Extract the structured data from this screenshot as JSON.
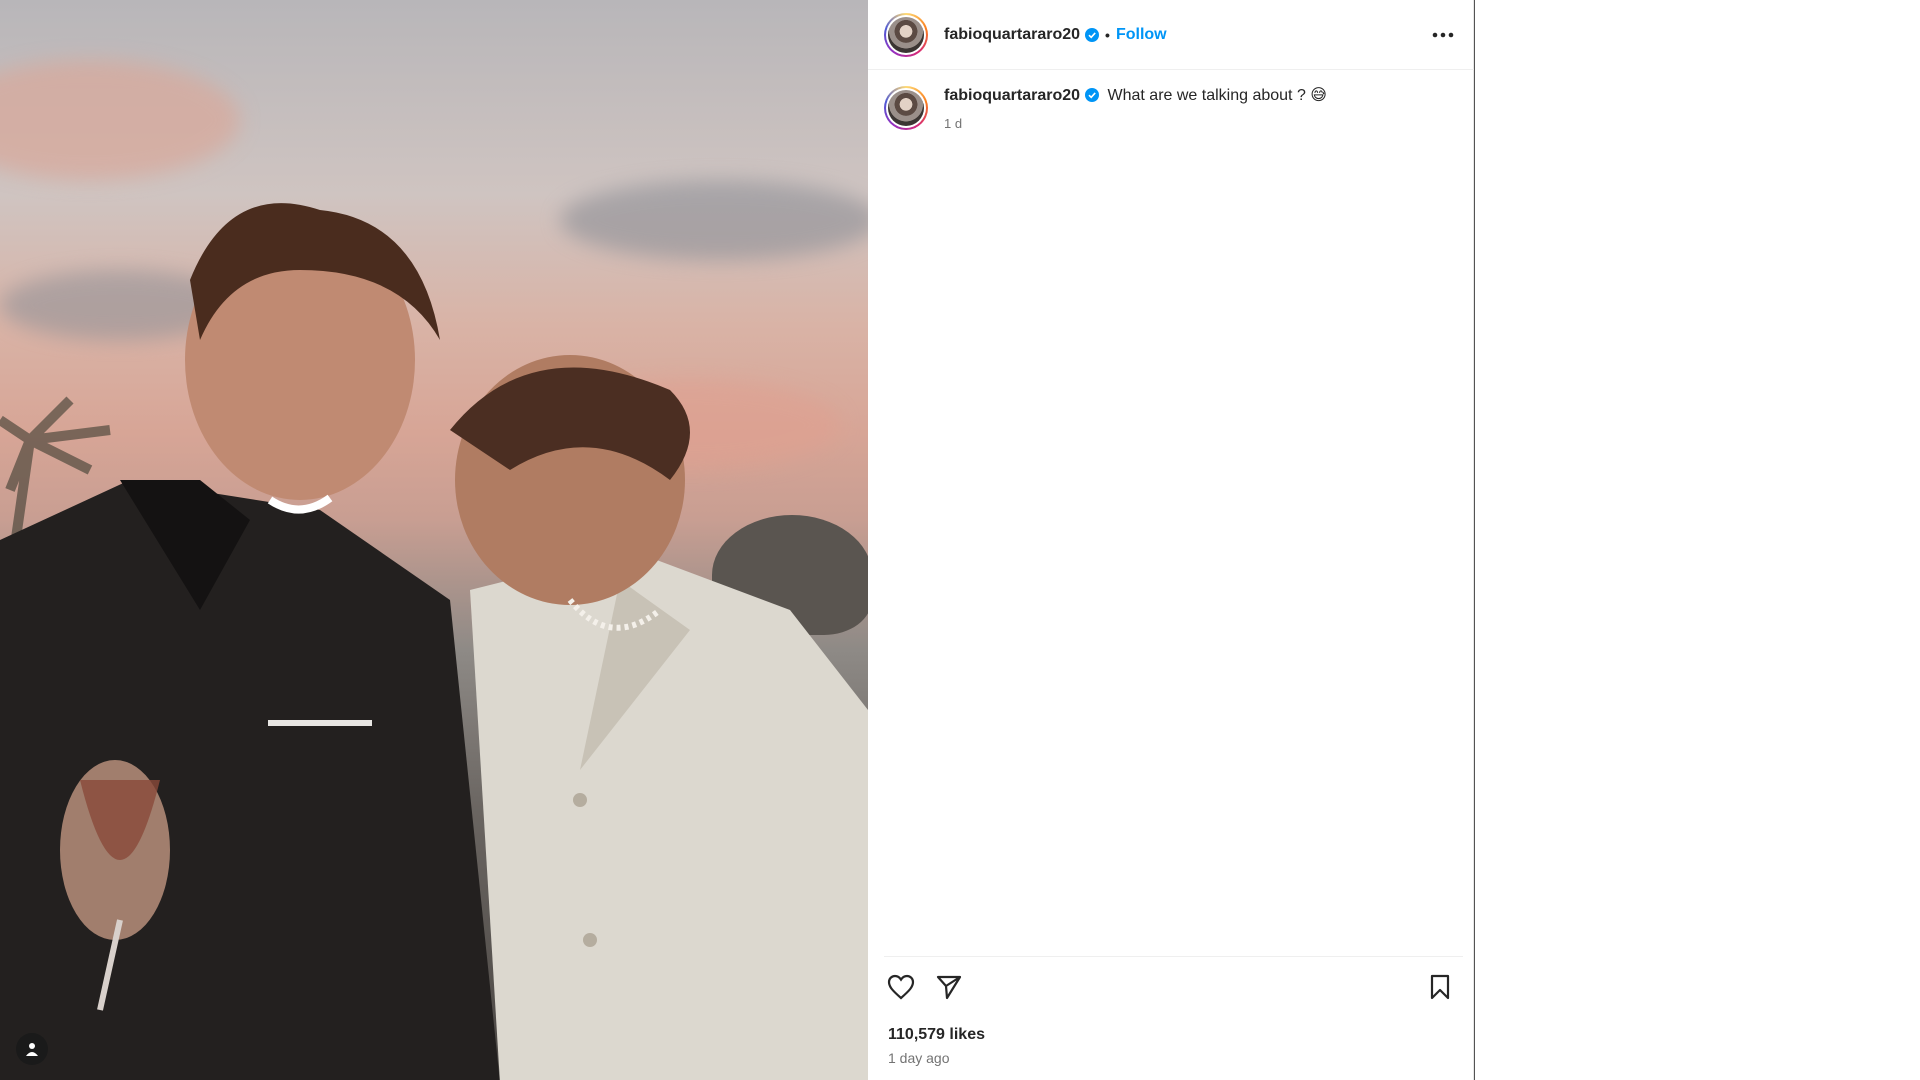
{
  "post": {
    "username": "fabioquartararo20",
    "follow_label": "Follow",
    "separator": "•",
    "caption": "What are we talking about ? 😅",
    "caption_time": "1 d",
    "likes": "110,579 likes",
    "posted_ago": "1 day ago"
  },
  "icons": {
    "verified": "verified-badge-icon",
    "more": "more-options-icon",
    "like": "heart-icon",
    "share": "send-icon",
    "save": "bookmark-icon",
    "tag": "user-tag-icon"
  },
  "colors": {
    "accent": "#0095f6",
    "text": "#262626",
    "muted": "#737373",
    "verified": "#0095f6"
  }
}
